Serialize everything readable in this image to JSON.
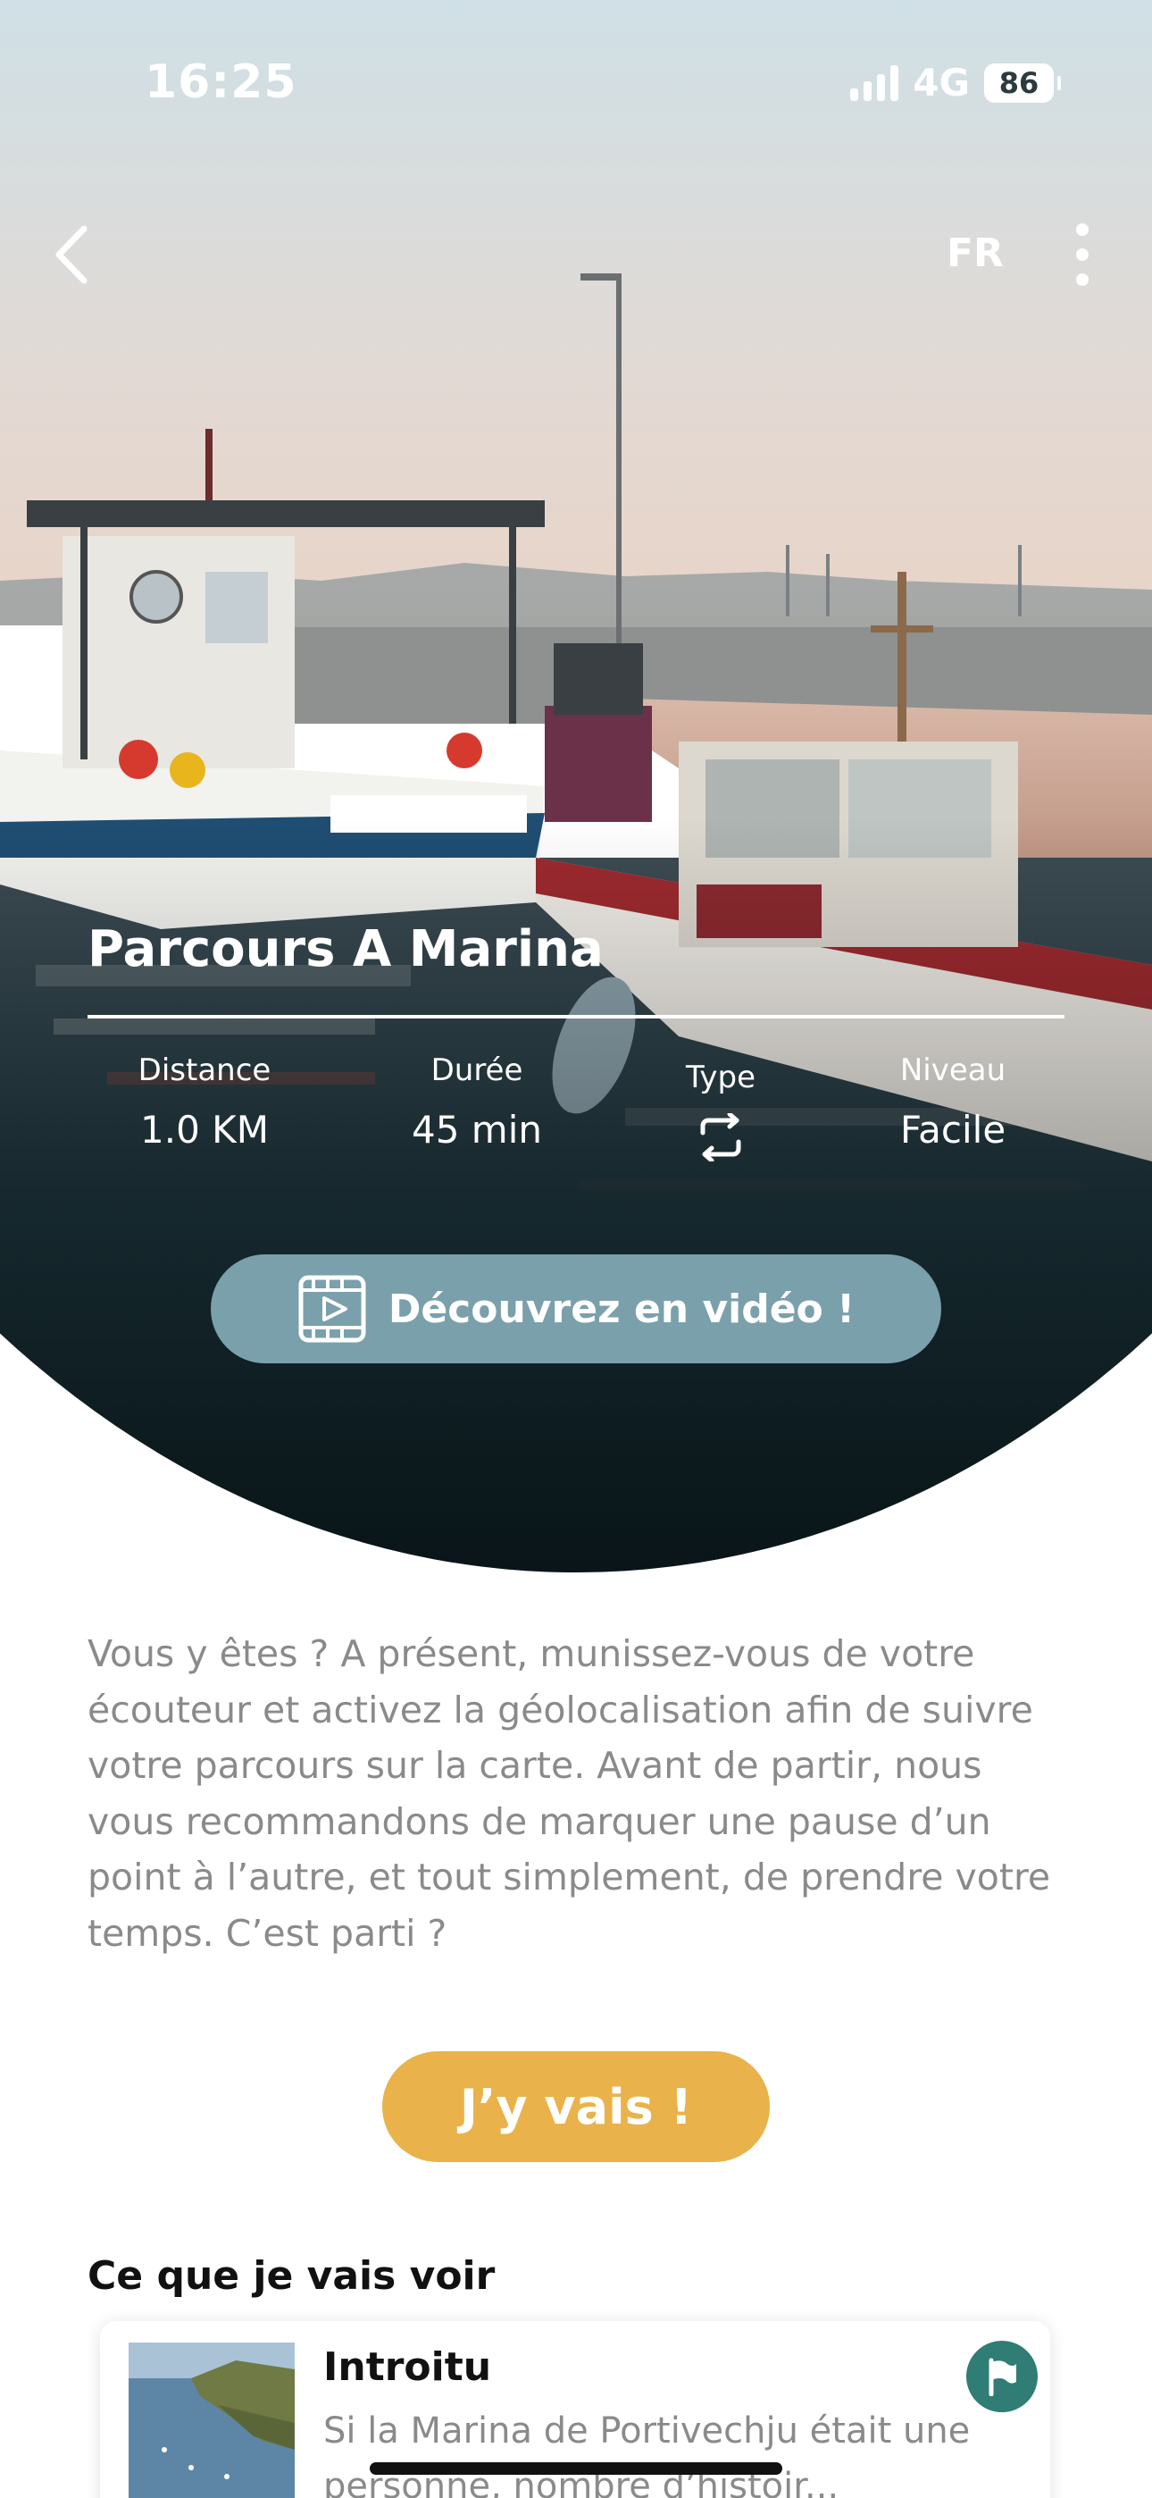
{
  "status_bar": {
    "time": "16:25",
    "network": "4G",
    "battery": "86"
  },
  "header": {
    "language": "FR"
  },
  "route": {
    "title": "Parcours A Marina",
    "stats": [
      {
        "label": "Distance",
        "value": "1.0 KM"
      },
      {
        "label": "Durée",
        "value": "45 min"
      },
      {
        "label": "Type",
        "icon": "loop-arrows-icon"
      },
      {
        "label": "Niveau",
        "value": "Facile"
      }
    ],
    "video_button_label": "Découvrez en vidéo !"
  },
  "description": "Vous y êtes ? A présent, munissez-vous de votre écouteur et activez la géolocalisation afin de suivre votre parcours sur la carte. Avant de partir, nous vous recommandons de marquer une pause d’un point à l’autre, et tout simplement, de prendre votre temps. C’est parti ?",
  "go_button_label": "J’y vais !",
  "section_title": "Ce que je vais voir",
  "poi": {
    "title": "Introitu",
    "description": "Si la Marina de Portivechju était une personne, nombre d’histoir..."
  },
  "colors": {
    "video_button": "#7aa0ab",
    "go_button": "#e9b24a",
    "flag_badge": "#2f7d74"
  }
}
